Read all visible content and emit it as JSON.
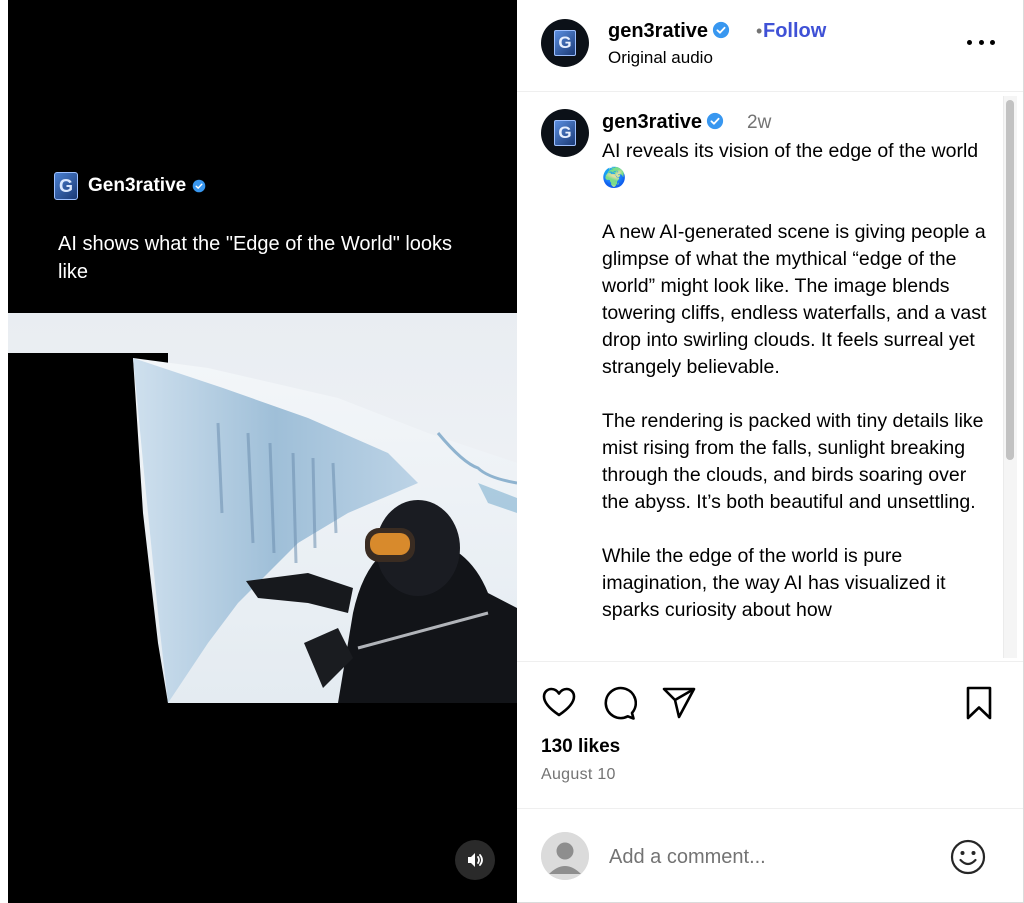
{
  "colors": {
    "follow": "#3f51d6",
    "verified": "#3897f0",
    "secondary_text": "#737373",
    "media_bg": "#000000"
  },
  "media": {
    "overlay_account": "Gen3rative",
    "overlay_title": "AI shows what the \"Edge of the World\" looks like",
    "volume_icon": "speaker-icon"
  },
  "header": {
    "username": "gen3rative",
    "separator": "•",
    "follow_label": "Follow",
    "audio": "Original audio",
    "more_icon": "more-options-icon"
  },
  "caption": {
    "username": "gen3rative",
    "time": "2w",
    "text": "AI reveals its vision of the edge of the world 🌍\n\nA new AI-generated scene is giving people a glimpse of what the mythical “edge of the world” might look like. The image blends towering cliffs, endless waterfalls, and a vast drop into swirling clouds. It feels surreal yet strangely believable.\n\nThe rendering is packed with tiny details like mist rising from the falls, sunlight breaking through the clouds, and birds soaring over the abyss. It’s both beautiful and unsettling.\n\nWhile the edge of the world is pure imagination, the way AI has visualized it sparks curiosity about how"
  },
  "actions": {
    "like_icon": "heart-icon",
    "comment_icon": "comment-icon",
    "share_icon": "send-icon",
    "save_icon": "bookmark-icon"
  },
  "stats": {
    "likes": "130 likes",
    "date": "August 10"
  },
  "comment": {
    "placeholder": "Add a comment...",
    "emoji_icon": "emoji-icon"
  }
}
